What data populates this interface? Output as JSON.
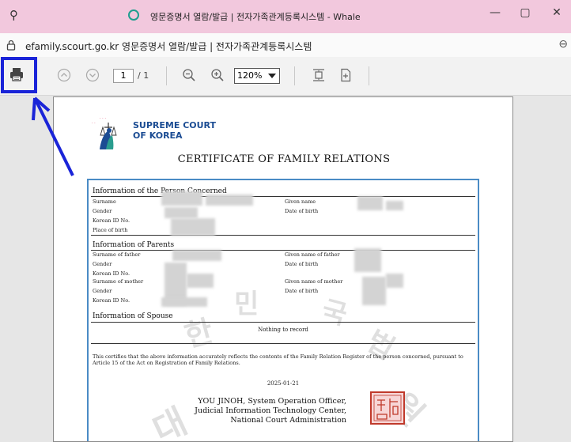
{
  "window": {
    "title": "영문증명서 열람/발급 | 전자가족관계등록시스템 - Whale",
    "min_glyph": "—",
    "max_glyph": "▢",
    "close_glyph": "✕",
    "pin_glyph": "⚲"
  },
  "address_bar": {
    "url_text": "efamily.scourt.go.kr 영문증명서 열람/발급 | 전자가족관계등록시스템"
  },
  "pdf_toolbar": {
    "current_page": "1",
    "total_pages": "/ 1",
    "zoom": "120%",
    "highlight_color": "#1a24d8"
  },
  "document": {
    "court_name_line1": "SUPREME COURT",
    "court_name_line2": "OF KOREA",
    "title": "CERTIFICATE OF FAMILY RELATIONS",
    "person_section": {
      "title": "Information of the Person Concerned",
      "surname": "Surname",
      "given_name": "Given name",
      "gender": "Gender",
      "date_of_birth": "Date of birth",
      "korean_id": "Korean ID No.",
      "place_of_birth": "Place of birth"
    },
    "parents_section": {
      "title": "Information of Parents",
      "surname_father": "Surname of father",
      "given_father": "Given name of father",
      "gender1": "Gender",
      "dob1": "Date of birth",
      "id1": "Korean ID No.",
      "surname_mother": "Surname of mother",
      "given_mother": "Given name of mother",
      "gender2": "Gender",
      "dob2": "Date of birth",
      "id2": "Korean ID No."
    },
    "spouse_section": {
      "title": "Information of Spouse",
      "nothing": "Nothing to record"
    },
    "certify_text": "This certifies that the above information accurately reflects the contents of the Family Relation Register of the person concerned, pursuant to Article 15 of the Act on Registration of Family Relations.",
    "date": "2025-01-21",
    "signature": {
      "line1": "YOU JINOH, System Operation Officer,",
      "line2": "Judicial Information Technology Center,",
      "line3": "National Court Administration"
    },
    "watermark": [
      "대",
      "한",
      "민",
      "국",
      "법",
      "원"
    ]
  }
}
